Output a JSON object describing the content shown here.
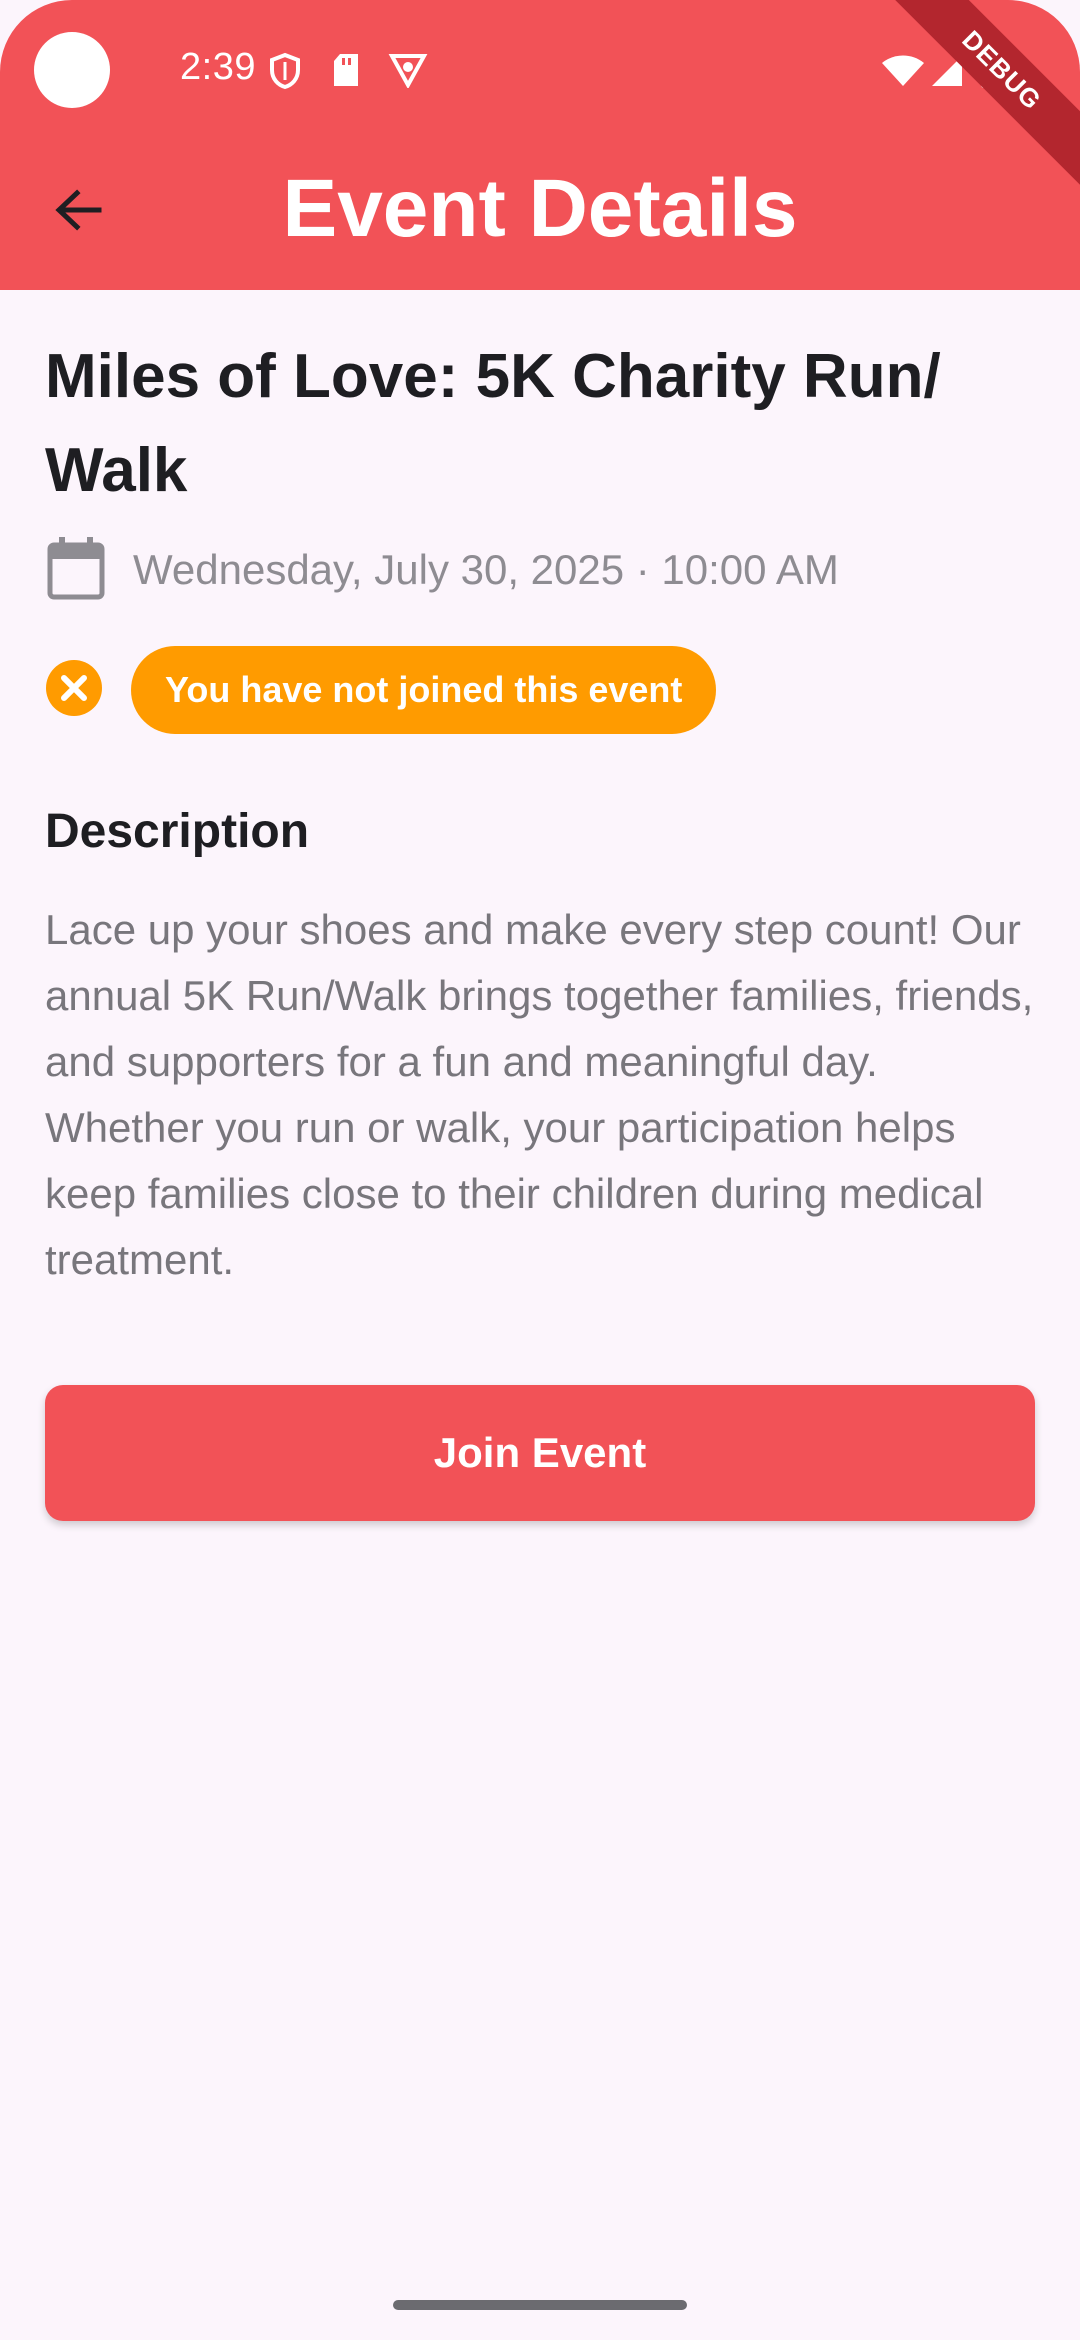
{
  "status_bar": {
    "time": "2:39",
    "icons": [
      "shield-icon",
      "sd-card-icon",
      "vpn-icon",
      "wifi-icon",
      "signal-icon",
      "battery-icon"
    ],
    "debug_label": "DEBUG"
  },
  "app_bar": {
    "title": "Event Details",
    "back_icon": "arrow-back-icon"
  },
  "event": {
    "title": "Miles of Love: 5K Charity Run/ Walk",
    "datetime": "Wednesday, July 30, 2025 · 10:00 AM",
    "join_status": "You have not joined this event",
    "description_heading": "Description",
    "description": "Lace up your shoes and make every step count! Our annual 5K Run/Walk brings together families, friends, and supporters for a fun and meaningful day. Whether you run or walk, your participation helps keep families close to their children during medical treatment."
  },
  "actions": {
    "join_label": "Join Event"
  },
  "colors": {
    "primary": "#f25257",
    "badge": "#ff9b00",
    "background": "#fcf5fc",
    "text_dark": "#1e1e22",
    "text_muted": "#8e8c92"
  }
}
